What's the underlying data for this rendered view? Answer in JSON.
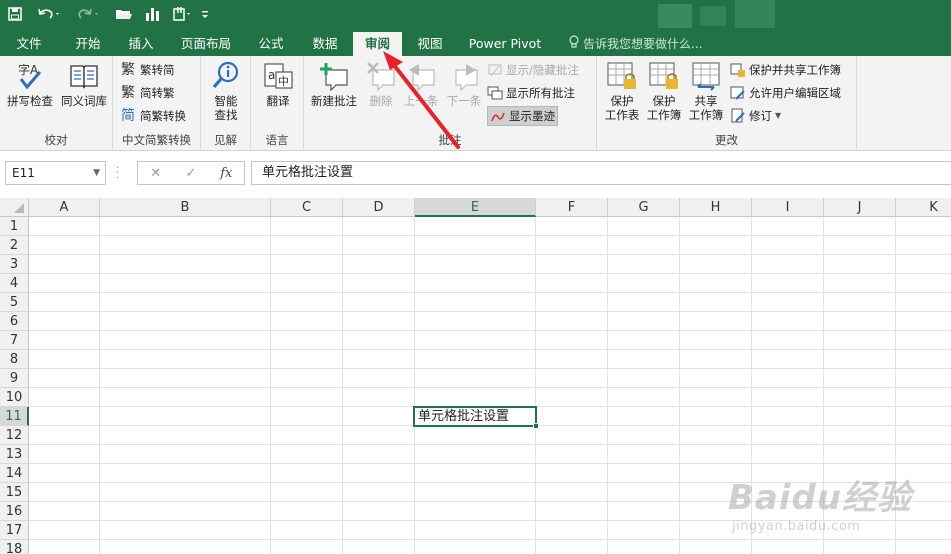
{
  "quick_access": {
    "save_icon": "save-icon",
    "undo_icon": "undo-icon",
    "redo_icon": "redo-icon",
    "open_icon": "folder-open-icon",
    "chart_icon": "bar-chart-icon",
    "clip_icon": "clip-icon",
    "more_icon": "customize-icon"
  },
  "tabs": [
    {
      "label": "文件"
    },
    {
      "label": "开始"
    },
    {
      "label": "插入"
    },
    {
      "label": "页面布局"
    },
    {
      "label": "公式"
    },
    {
      "label": "数据"
    },
    {
      "label": "审阅",
      "active": true
    },
    {
      "label": "视图"
    },
    {
      "label": "Power Pivot"
    }
  ],
  "tell_me": "告诉我您想要做什么...",
  "ribbon": {
    "proofing": {
      "label": "校对",
      "spell_check": "拼写检查",
      "thesaurus": "同义词库"
    },
    "chinese": {
      "label": "中文简繁转换",
      "to_trad": "繁转简",
      "to_simp": "简转繁",
      "convert": "简繁转换"
    },
    "insights": {
      "label": "见解",
      "smart_lookup": [
        "智能",
        "查找"
      ]
    },
    "language": {
      "label": "语言",
      "translate": "翻译"
    },
    "comments": {
      "label": "批注",
      "new": "新建批注",
      "delete": "删除",
      "prev": "上一条",
      "next": "下一条",
      "show_hide": "显示/隐藏批注",
      "show_all": "显示所有批注",
      "show_ink": "显示墨迹"
    },
    "changes": {
      "label": "更改",
      "protect_sheet": [
        "保护",
        "工作表"
      ],
      "protect_workbook": [
        "保护",
        "工作簿"
      ],
      "share_workbook": [
        "共享",
        "工作簿"
      ],
      "protect_share": "保护并共享工作簿",
      "allow_edit": "允许用户编辑区域",
      "track": "修订"
    }
  },
  "formula_bar": {
    "name_box": "E11",
    "formula": "单元格批注设置"
  },
  "sheet": {
    "columns": [
      "A",
      "B",
      "C",
      "D",
      "E",
      "F",
      "G",
      "H",
      "I",
      "J",
      "K"
    ],
    "selected_column": "E",
    "rows": [
      "1",
      "2",
      "3",
      "4",
      "5",
      "6",
      "7",
      "8",
      "9",
      "10",
      "11",
      "12",
      "13",
      "14",
      "15",
      "16",
      "17",
      "18"
    ],
    "selected_row": "11",
    "active_cell": {
      "ref": "E11",
      "value": "单元格批注设置"
    }
  },
  "watermark": {
    "brand": "Baidu经验",
    "url": "jingyan.baidu.com"
  },
  "colors": {
    "accent": "#217346",
    "annotation": "#e5232b"
  }
}
